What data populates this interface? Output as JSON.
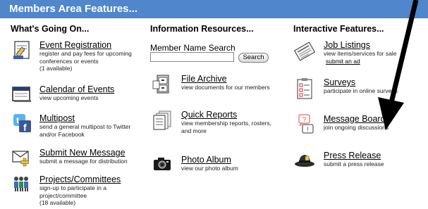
{
  "header": {
    "title": "Members Area Features..."
  },
  "columns": [
    {
      "heading": "What's Going On..."
    },
    {
      "heading": "Information Resources..."
    },
    {
      "heading": "Interactive Features..."
    }
  ],
  "col1": {
    "event_registration": {
      "title": "Event Registration",
      "desc1": "register and pay fees for upcoming",
      "desc2": "conferences or events",
      "desc3": "(1 available)"
    },
    "calendar": {
      "title": "Calendar of Events",
      "desc1": "view upcoming events"
    },
    "multipost": {
      "title": "Multipost",
      "desc1": "send a general multipost to Twitter",
      "desc2": "and/or Facebook"
    },
    "submit_message": {
      "title": "Submit New Message",
      "desc1": "submit a message for distribution"
    },
    "projects": {
      "title": "Projects/Committees",
      "desc1": "sign-up to participate in a",
      "desc2": "project/committee",
      "desc3": "(18 available)"
    }
  },
  "col2": {
    "search": {
      "label": "Member Name Search",
      "button": "Search",
      "value": ""
    },
    "file_archive": {
      "title": "File Archive",
      "desc1": "view documents for our members"
    },
    "quick_reports": {
      "title": "Quick Reports",
      "desc1": "view membership reports, rosters,",
      "desc2": "and more"
    },
    "photo_album": {
      "title": "Photo Album",
      "desc1": "view our photo album"
    }
  },
  "col3": {
    "job_listings": {
      "title": "Job Listings",
      "desc1": "view items/services for sale",
      "link": "submit an ad"
    },
    "surveys": {
      "title": "Surveys",
      "desc1": "participate in online surveys"
    },
    "message_boards": {
      "title": "Message Boards",
      "desc1": "join ongoing discussions"
    },
    "press_release": {
      "title": "Press Release",
      "desc1": "submit a press release"
    }
  },
  "colors": {
    "header_bg": "#4f86cc",
    "header_text": "#ffffff",
    "arrow": "#000000"
  },
  "icons": [
    "registration-icon",
    "calendar-icon",
    "twitter-facebook-icon",
    "message-envelope-icon",
    "people-icon",
    "file-cabinet-icon",
    "report-icon",
    "camera-icon",
    "newspaper-icon",
    "survey-icon",
    "speech-bubbles-icon",
    "press-hat-icon",
    "annotation-arrow"
  ]
}
